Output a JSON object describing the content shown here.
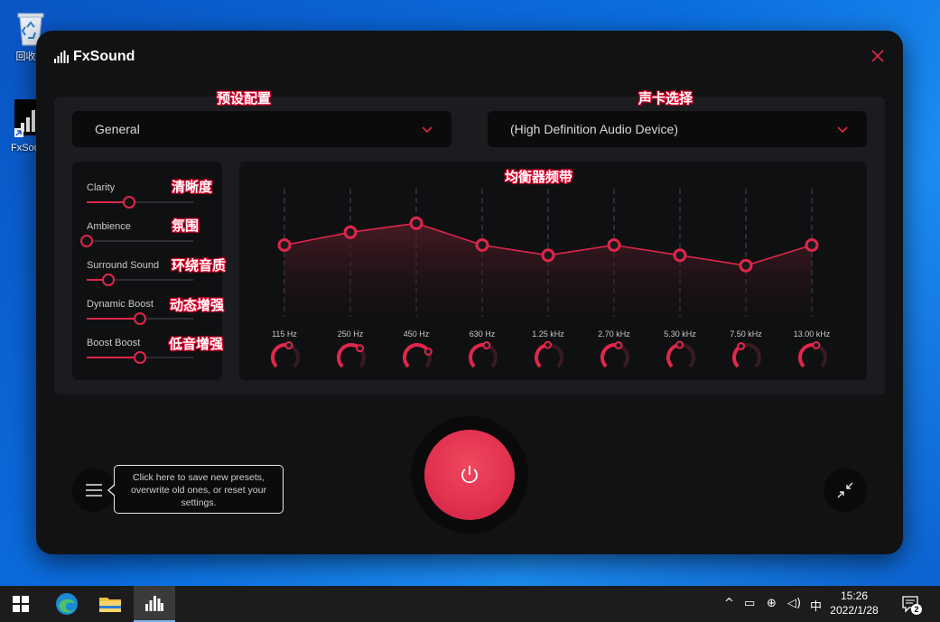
{
  "desktop": {
    "icons": [
      {
        "label": "回收站"
      },
      {
        "label": "FxSound"
      }
    ]
  },
  "app": {
    "title": "FxSound",
    "preset": {
      "label": "General"
    },
    "device": {
      "label": "(High Definition Audio Device)"
    },
    "effects": [
      {
        "label": "Clarity",
        "value": 0.4
      },
      {
        "label": "Ambience",
        "value": 0.0
      },
      {
        "label": "Surround Sound",
        "value": 0.2
      },
      {
        "label": "Dynamic Boost",
        "value": 0.5
      },
      {
        "label": "Boost Boost",
        "value": 0.5
      }
    ],
    "eq_bands": [
      {
        "label": "115 Hz",
        "level": 0.56
      },
      {
        "label": "250 Hz",
        "level": 0.66
      },
      {
        "label": "450 Hz",
        "level": 0.73
      },
      {
        "label": "630 Hz",
        "level": 0.56
      },
      {
        "label": "1.25 kHz",
        "level": 0.48
      },
      {
        "label": "2.70 kHz",
        "level": 0.56
      },
      {
        "label": "5.30 kHz",
        "level": 0.48
      },
      {
        "label": "7.50 kHz",
        "level": 0.4
      },
      {
        "label": "13.00 kHz",
        "level": 0.56
      }
    ],
    "tooltip": {
      "line1": "Click here to save new presets,",
      "line2": "overwrite old ones, or reset your",
      "line3": "settings."
    },
    "colors": {
      "accent": "#e0264a",
      "background": "#111214",
      "panel": "#1b1c1f"
    }
  },
  "annotations": {
    "preset": "预设配置",
    "device": "声卡选择",
    "eq": "均衡器频带",
    "clarity": "清晰度",
    "ambience": "氛围",
    "surround": "环绕音质",
    "dynamic": "动态增强",
    "bass": "低音增强"
  },
  "taskbar": {
    "time": "15:26",
    "date": "2022/1/28",
    "ime": "中",
    "notification_count": "2"
  }
}
